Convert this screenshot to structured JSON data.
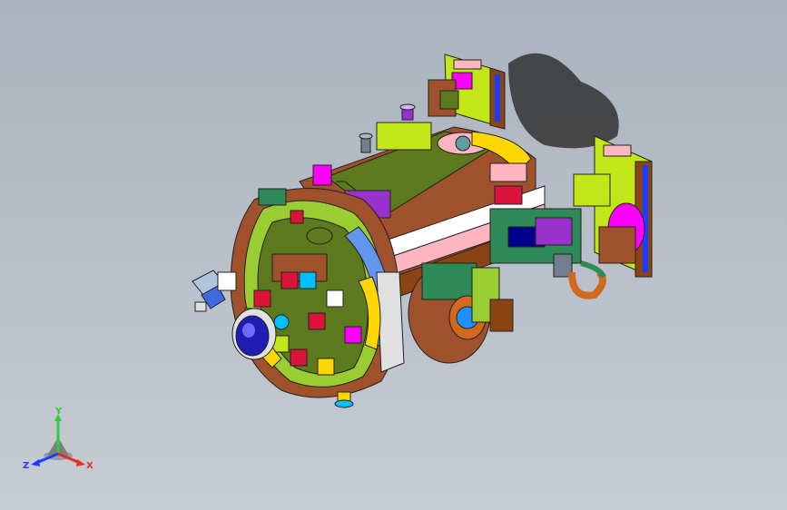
{
  "viewport": {
    "background_top": "#aab2bd",
    "background_bottom": "#c7ccd3"
  },
  "model": {
    "name": "assembly-model",
    "palette": [
      "#5e7a1e",
      "#9acd32",
      "#c3e619",
      "#2e8b57",
      "#dc143c",
      "#ff00ff",
      "#9932cc",
      "#8b4513",
      "#a0522d",
      "#d2691e",
      "#ffb6c1",
      "#ffffff",
      "#00bfff",
      "#00008b",
      "#ffd700",
      "#ff4500"
    ]
  },
  "triad": {
    "y_label": "Y",
    "x_label": "X",
    "z_label": "Z",
    "y_color": "#2ecc40",
    "x_color": "#e0301e",
    "z_color": "#1e3cff"
  }
}
